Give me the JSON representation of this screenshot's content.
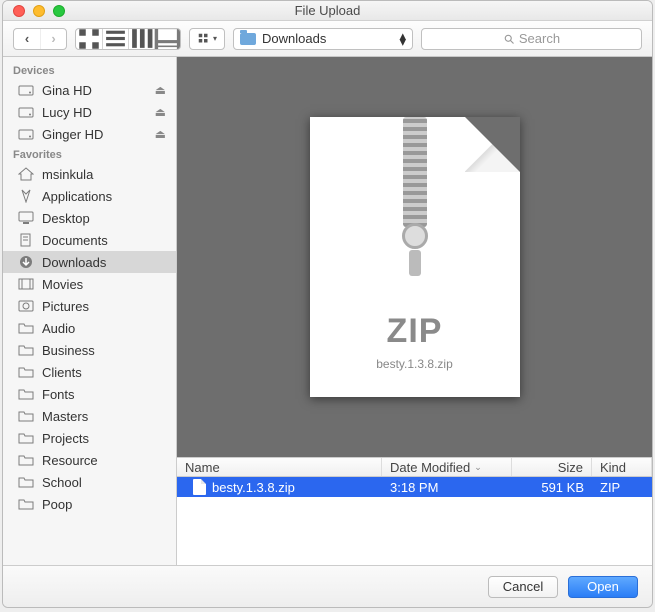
{
  "title": "File Upload",
  "location": {
    "name": "Downloads"
  },
  "search_placeholder": "Search",
  "sidebar": {
    "sections": [
      {
        "label": "Devices",
        "items": [
          {
            "label": "Gina HD",
            "icon": "hdd-icon",
            "eject": true
          },
          {
            "label": "Lucy HD",
            "icon": "hdd-icon",
            "eject": true
          },
          {
            "label": "Ginger HD",
            "icon": "hdd-icon",
            "eject": true
          }
        ]
      },
      {
        "label": "Favorites",
        "items": [
          {
            "label": "msinkula",
            "icon": "home-icon"
          },
          {
            "label": "Applications",
            "icon": "apps-icon"
          },
          {
            "label": "Desktop",
            "icon": "desktop-icon"
          },
          {
            "label": "Documents",
            "icon": "documents-icon"
          },
          {
            "label": "Downloads",
            "icon": "downloads-icon",
            "selected": true
          },
          {
            "label": "Movies",
            "icon": "movies-icon"
          },
          {
            "label": "Pictures",
            "icon": "pictures-icon"
          },
          {
            "label": "Audio",
            "icon": "folder-icon"
          },
          {
            "label": "Business",
            "icon": "folder-icon"
          },
          {
            "label": "Clients",
            "icon": "folder-icon"
          },
          {
            "label": "Fonts",
            "icon": "folder-icon"
          },
          {
            "label": "Masters",
            "icon": "folder-icon"
          },
          {
            "label": "Projects",
            "icon": "folder-icon"
          },
          {
            "label": "Resource",
            "icon": "folder-icon"
          },
          {
            "label": "School",
            "icon": "folder-icon"
          },
          {
            "label": "Poop",
            "icon": "folder-icon"
          }
        ]
      }
    ]
  },
  "columns": {
    "name": "Name",
    "date": "Date Modified",
    "size": "Size",
    "kind": "Kind"
  },
  "files": [
    {
      "name": "besty.1.3.8.zip",
      "date": "3:18 PM",
      "size": "591 KB",
      "kind": "ZIP",
      "selected": true
    }
  ],
  "preview": {
    "type_label": "ZIP",
    "filename": "besty.1.3.8.zip"
  },
  "buttons": {
    "cancel": "Cancel",
    "open": "Open"
  }
}
